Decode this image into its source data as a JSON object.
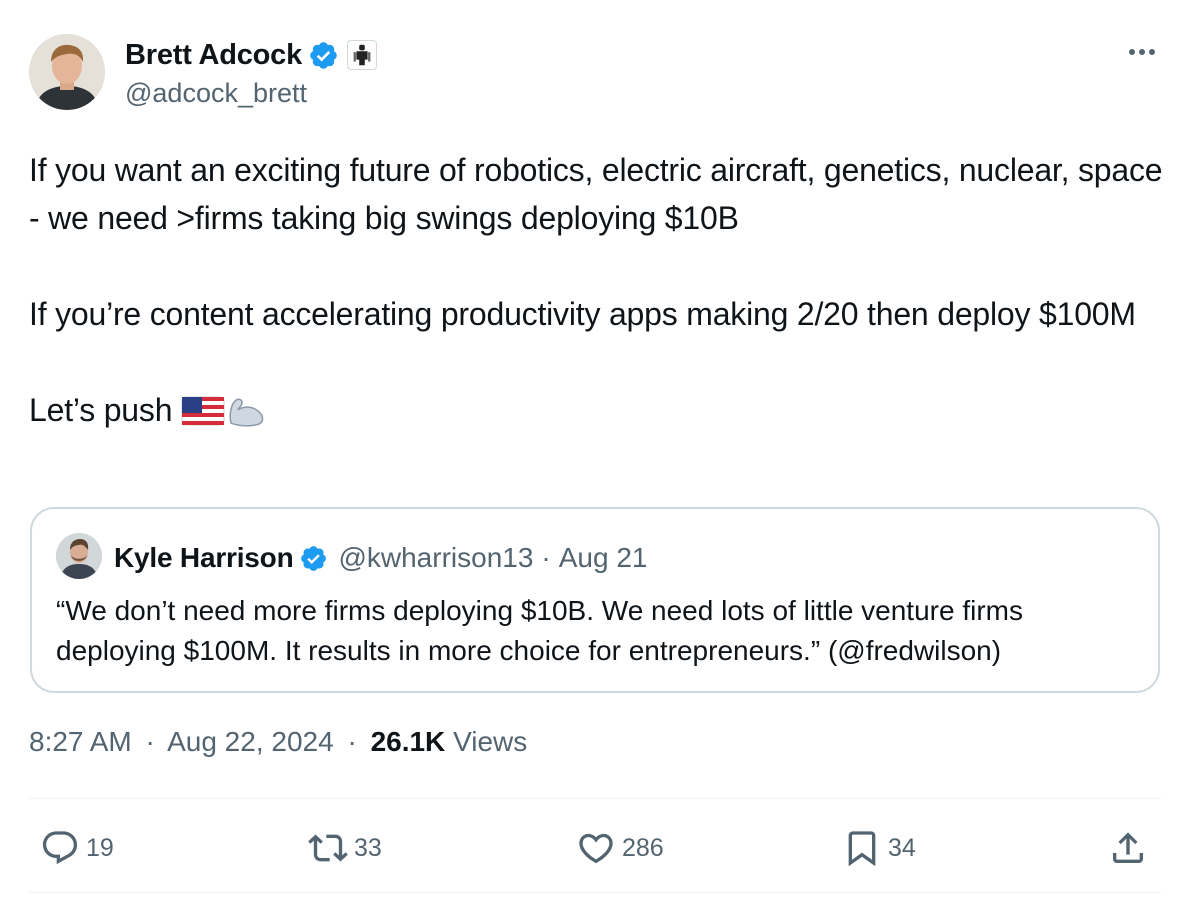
{
  "author": {
    "display_name": "Brett Adcock",
    "handle": "@adcock_brett",
    "verified": true,
    "affiliation_badge": "robot-figure-icon"
  },
  "tweet": {
    "paragraphs": [
      "If you want an exciting future of robotics, electric aircraft, genetics, nuclear, space - we need >firms taking big swings deploying $10B",
      "If you’re content accelerating productivity apps making 2/20 then deploy $100M",
      "Let’s push"
    ],
    "trailing_emoji": [
      "us-flag-emoji",
      "flexed-biceps-emoji"
    ]
  },
  "quote": {
    "display_name": "Kyle Harrison",
    "handle": "@kwharrison13",
    "separator": "·",
    "date": "Aug 21",
    "text": "“We don’t need more firms deploying $10B. We need lots of little venture firms deploying $100M. It results in more choice for entrepreneurs.” (@fredwilson)"
  },
  "meta": {
    "time": "8:27 AM",
    "separator": "·",
    "date": "Aug 22, 2024",
    "views_count": "26.1K",
    "views_label": "Views"
  },
  "actions": {
    "replies": "19",
    "reposts": "33",
    "likes": "286",
    "bookmarks": "34"
  },
  "colors": {
    "text": "#0f1419",
    "secondary": "#536471",
    "verified": "#1d9bf0",
    "border": "#cfd9de"
  }
}
